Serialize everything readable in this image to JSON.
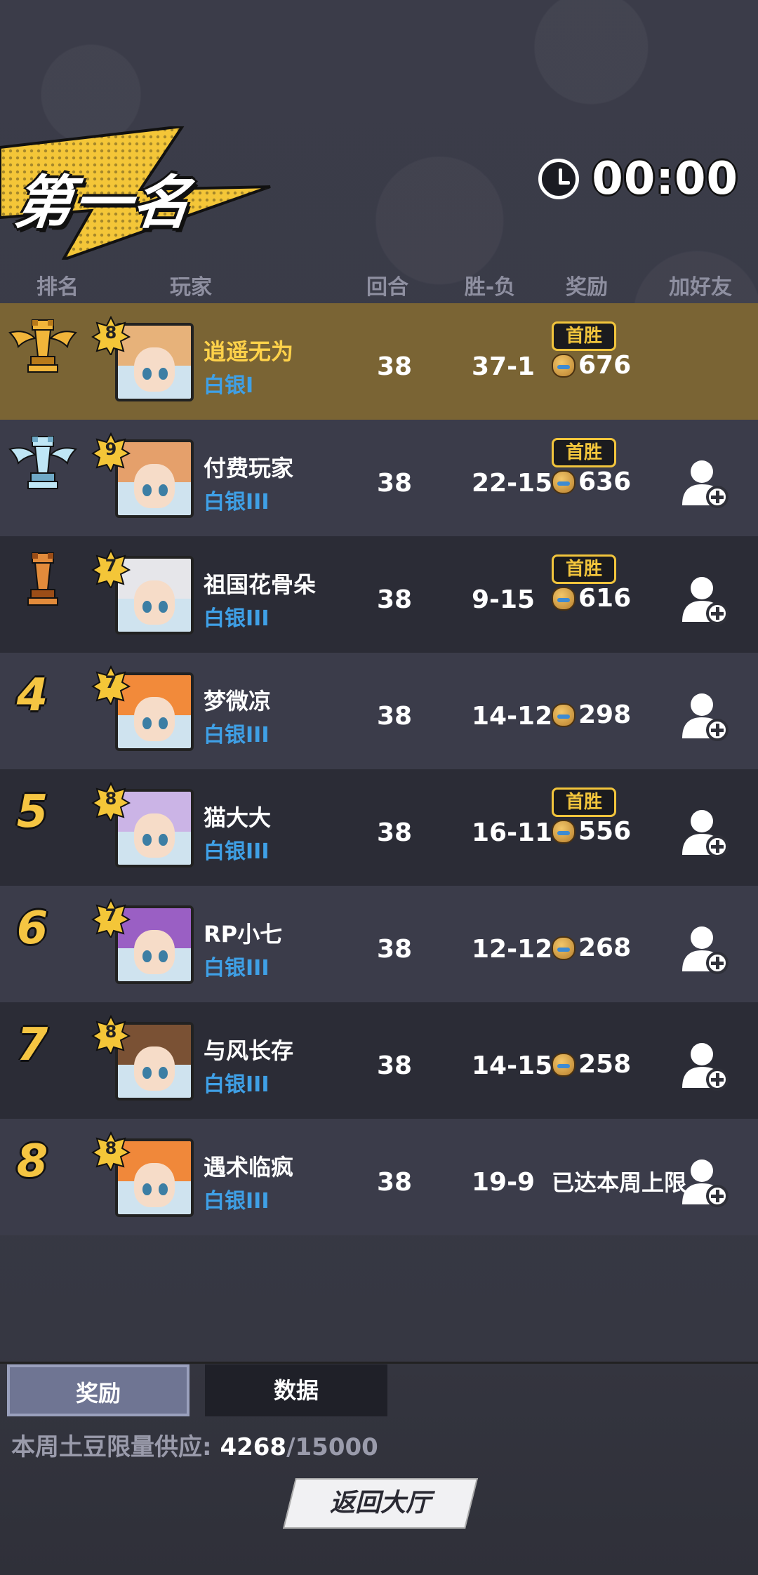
{
  "banner": {
    "title": "第一名"
  },
  "timer": {
    "value": "00:00"
  },
  "headers": {
    "rank": "排名",
    "player": "玩家",
    "rounds": "回合",
    "win_loss": "胜-负",
    "reward": "奖励",
    "add_friend": "加好友"
  },
  "rows": [
    {
      "rank": "1",
      "level": "8",
      "name": "逍遥无为",
      "tier": "白银I",
      "rounds": "38",
      "wl": "37-1",
      "first_win": "首胜",
      "reward": "676",
      "trophy": "gold",
      "hair": "#e7b27a"
    },
    {
      "rank": "2",
      "level": "9",
      "name": "付费玩家",
      "tier": "白银III",
      "rounds": "38",
      "wl": "22-15",
      "first_win": "首胜",
      "reward": "636",
      "trophy": "silver",
      "hair": "#e5a06b"
    },
    {
      "rank": "3",
      "level": "7",
      "name": "祖国花骨朵",
      "tier": "白银III",
      "rounds": "38",
      "wl": "9-15",
      "first_win": "首胜",
      "reward": "616",
      "trophy": "bronze",
      "hair": "#e6e6ea"
    },
    {
      "rank": "4",
      "level": "7",
      "name": "梦微凉",
      "tier": "白银III",
      "rounds": "38",
      "wl": "14-12",
      "reward": "298",
      "hair": "#f28a3a"
    },
    {
      "rank": "5",
      "level": "8",
      "name": "猫大大",
      "tier": "白银III",
      "rounds": "38",
      "wl": "16-11",
      "first_win": "首胜",
      "reward": "556",
      "hair": "#cbb4e6"
    },
    {
      "rank": "6",
      "level": "7",
      "name": "RP小七",
      "tier": "白银III",
      "rounds": "38",
      "wl": "12-12",
      "reward": "268",
      "hair": "#9a5fc4"
    },
    {
      "rank": "7",
      "level": "8",
      "name": "与风长存",
      "tier": "白银III",
      "rounds": "38",
      "wl": "14-15",
      "reward": "258",
      "hair": "#7a5134"
    },
    {
      "rank": "8",
      "level": "8",
      "name": "遇术临疯",
      "tier": "白银III",
      "rounds": "38",
      "wl": "19-9",
      "reward_text": "已达本周上限",
      "hair": "#f0883a"
    }
  ],
  "tabs": {
    "reward": "奖励",
    "data": "数据"
  },
  "supply": {
    "label": "本周土豆限量供应:",
    "current": "4268",
    "max": "/15000"
  },
  "back_button": "返回大厅"
}
